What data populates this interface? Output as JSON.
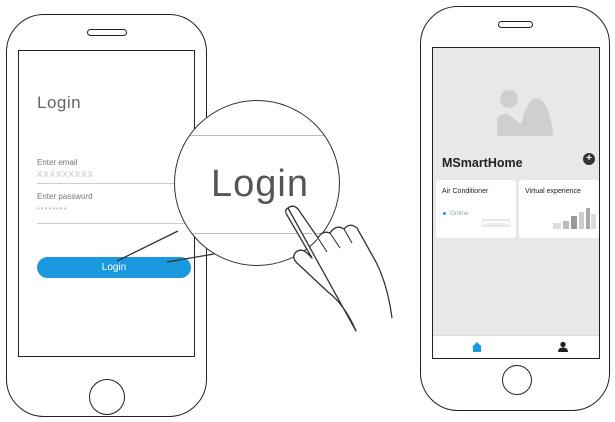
{
  "login_screen": {
    "title": "Login",
    "email_label": "Enter  email",
    "email_placeholder": "XXXXXXXXX",
    "password_label": "Enter  password",
    "password_value": "••••••••",
    "login_button": "Login"
  },
  "magnifier": {
    "text": "Login"
  },
  "home_screen": {
    "app_title": "MSmartHome",
    "add_icon": "plus-icon",
    "cards": [
      {
        "title": "Air Conditioner",
        "status": "Online"
      },
      {
        "title": "Virtual experience"
      }
    ],
    "tabs": [
      {
        "icon": "home-icon",
        "active": true
      },
      {
        "icon": "user-icon",
        "active": false
      }
    ]
  },
  "colors": {
    "accent": "#1a99de",
    "screen_bg": "#e8e8e8",
    "line": "#222222"
  }
}
